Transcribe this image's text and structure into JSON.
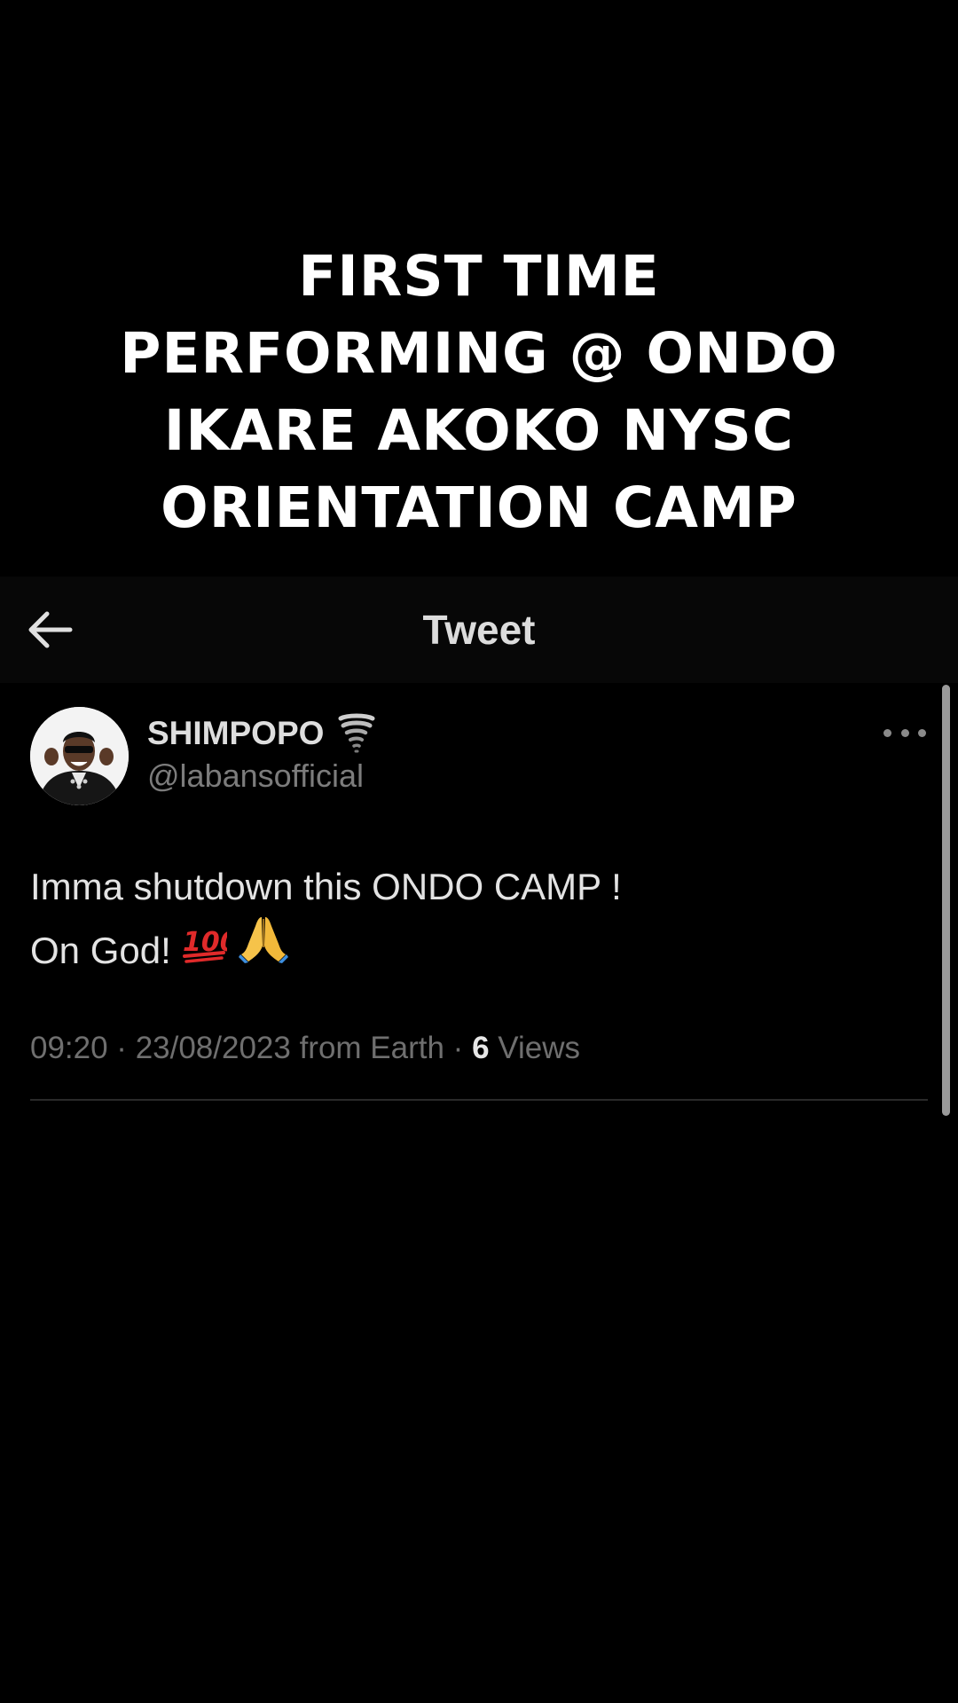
{
  "overlay": {
    "lines": [
      "FIRST TIME",
      "PERFORMING @ ONDO",
      "IKARE AKOKO NYSC",
      "ORIENTATION CAMP"
    ]
  },
  "header": {
    "title": "Tweet",
    "back_icon": "arrow-left-icon"
  },
  "tweet": {
    "display_name": "SHIMPOPO",
    "badge_icon": "tornado-emoji-icon",
    "handle": "@labansofficial",
    "body_line1": "Imma shutdown this ONDO CAMP !",
    "body_line2": "On God!",
    "body_emojis": [
      "hundred-points-emoji-icon",
      "folded-hands-emoji-icon"
    ],
    "timestamp": "09:20 · 23/08/2023 from Earth · ",
    "views_count": "6",
    "views_label": " Views",
    "more_icon": "more-horizontal-icon"
  },
  "colors": {
    "background": "#000000",
    "header_bg": "#070707",
    "secondary_text": "#6f6f6f"
  }
}
